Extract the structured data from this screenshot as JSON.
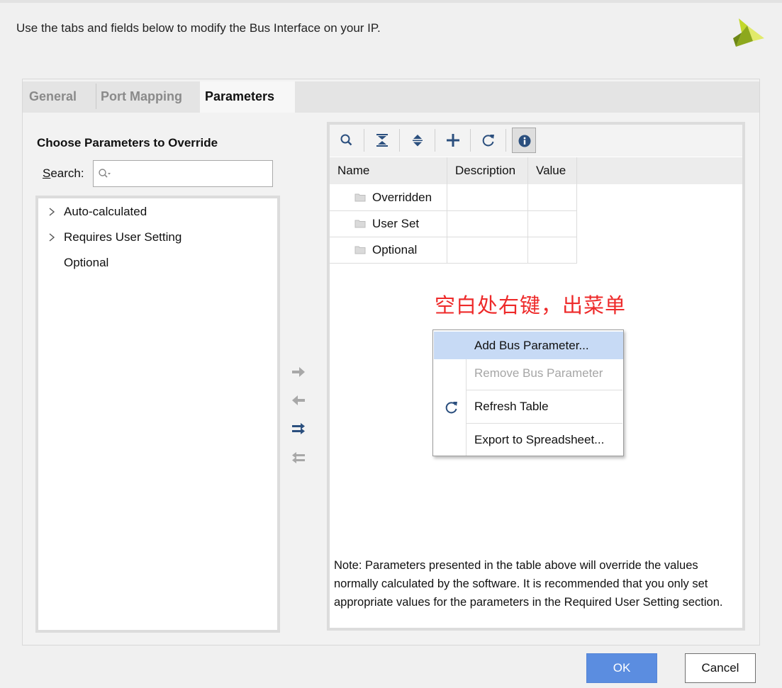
{
  "header": {
    "instruction": "Use the tabs and fields below to modify the Bus Interface on your IP."
  },
  "tabs": [
    {
      "label": "General",
      "active": false
    },
    {
      "label": "Port Mapping",
      "active": false
    },
    {
      "label": "Parameters",
      "active": true
    }
  ],
  "left_pane": {
    "title": "Choose Parameters to Override",
    "search_label": "Search:",
    "search_value": "",
    "tree": [
      {
        "label": "Auto-calculated",
        "expandable": true
      },
      {
        "label": "Requires User Setting",
        "expandable": true
      },
      {
        "label": "Optional",
        "expandable": false
      }
    ]
  },
  "move_buttons": [
    "arrow-right-icon",
    "arrow-left-icon",
    "double-arrow-right-icon",
    "double-arrow-left-icon"
  ],
  "toolbar": [
    "search-icon",
    "collapse-all-icon",
    "expand-all-icon",
    "add-icon",
    "refresh-icon",
    "info-icon"
  ],
  "table": {
    "columns": [
      "Name",
      "Description",
      "Value"
    ],
    "rows": [
      {
        "name": "Overridden",
        "description": "",
        "value": ""
      },
      {
        "name": "User Set",
        "description": "",
        "value": ""
      },
      {
        "name": "Optional",
        "description": "",
        "value": ""
      }
    ]
  },
  "annotation": "空白处右键，出菜单",
  "context_menu": {
    "items": [
      {
        "label": "Add Bus Parameter...",
        "enabled": true,
        "highlighted": true
      },
      {
        "label": "Remove Bus Parameter",
        "enabled": false
      },
      {
        "label": "Refresh Table",
        "enabled": true,
        "icon": "refresh-icon"
      },
      {
        "label": "Export to Spreadsheet...",
        "enabled": true
      }
    ]
  },
  "note": "Note: Parameters presented in the table above will override the values normally calculated by the software. It is recommended that you only set appropriate values for the parameters in the Required User Setting section.",
  "buttons": {
    "ok": "OK",
    "cancel": "Cancel"
  },
  "colors": {
    "accent": "#5b8de0",
    "annotation": "#ee2a2a",
    "menu_highlight": "#c7daf5",
    "icon_blue": "#2b4f7e"
  }
}
